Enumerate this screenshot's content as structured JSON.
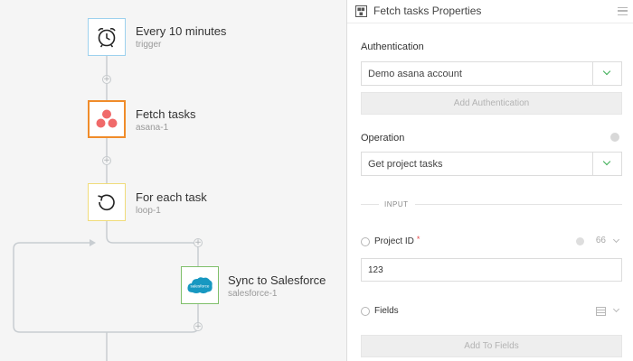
{
  "workflow": {
    "nodes": [
      {
        "title": "Every 10 minutes",
        "subtitle": "trigger",
        "icon": "alarm-clock-icon"
      },
      {
        "title": "Fetch tasks",
        "subtitle": "asana-1",
        "icon": "asana-icon"
      },
      {
        "title": "For each task",
        "subtitle": "loop-1",
        "icon": "loop-arrow-icon"
      },
      {
        "title": "Sync to Salesforce",
        "subtitle": "salesforce-1",
        "icon": "salesforce-icon",
        "icon_text": "salesforce"
      }
    ],
    "add_step_icon": "plus-icon",
    "add_step_glyph": "+"
  },
  "panel": {
    "title": "Fetch tasks Properties",
    "header_icon_text": "■■ ■",
    "authentication": {
      "label": "Authentication",
      "selected": "Demo asana account",
      "add_button": "Add Authentication"
    },
    "operation": {
      "label": "Operation",
      "selected": "Get project tasks"
    },
    "section_label": "INPUT",
    "fields": [
      {
        "label": "Project ID",
        "required_mark": "*",
        "type_badge": "66",
        "value": "123"
      },
      {
        "label": "Fields"
      }
    ],
    "add_fields_button": "Add To Fields"
  },
  "colors": {
    "trigger_border": "#9dd1ee",
    "asana_border": "#f08c2a",
    "loop_border": "#f0dc7a",
    "salesforce_border": "#7fbf6a",
    "asana_dots": "#f06a6a",
    "salesforce_blue": "#1798c1",
    "caret_green": "#3cae55",
    "required_red": "#e34c4c"
  }
}
